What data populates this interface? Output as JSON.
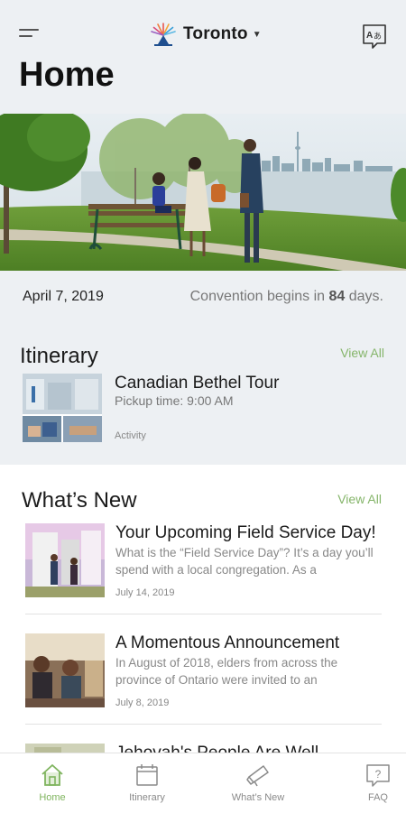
{
  "header": {
    "menu_icon": "hamburger-menu-icon",
    "city": "Toronto",
    "language_icon": "translate-icon"
  },
  "page": {
    "title": "Home"
  },
  "convention": {
    "date": "April 7, 2019",
    "countdown_prefix": "Convention begins in",
    "countdown_days": "84",
    "countdown_suffix": "days."
  },
  "itinerary": {
    "title": "Itinerary",
    "view_all": "View All",
    "item": {
      "title": "Canadian Bethel Tour",
      "subtitle": "Pickup time: 9:00 AM",
      "tag": "Activity"
    }
  },
  "whats_new": {
    "title": "What’s New",
    "view_all": "View All",
    "items": [
      {
        "title": "Your Upcoming Field Service Day!",
        "summary": "What is the “Field Service Day”? It’s a day you’ll spend with a local congregation. As a",
        "date": "July 14, 2019"
      },
      {
        "title": "A Momentous Announcement",
        "summary": "In August of 2018, elders from across the province of Ontario were invited to an",
        "date": "July 8, 2019"
      },
      {
        "title": "Jehovah's People Are Well"
      }
    ]
  },
  "tabs": [
    {
      "label": "Home",
      "icon": "home-icon",
      "active": true
    },
    {
      "label": "Itinerary",
      "icon": "calendar-icon",
      "active": false
    },
    {
      "label": "What’s New",
      "icon": "megaphone-icon",
      "active": false
    },
    {
      "label": "FAQ",
      "icon": "question-bubble-icon",
      "active": false
    }
  ],
  "colors": {
    "accent": "#85b56a",
    "background_top": "#edf0f3",
    "text_primary": "#1b1b1b",
    "text_secondary": "#888888"
  }
}
